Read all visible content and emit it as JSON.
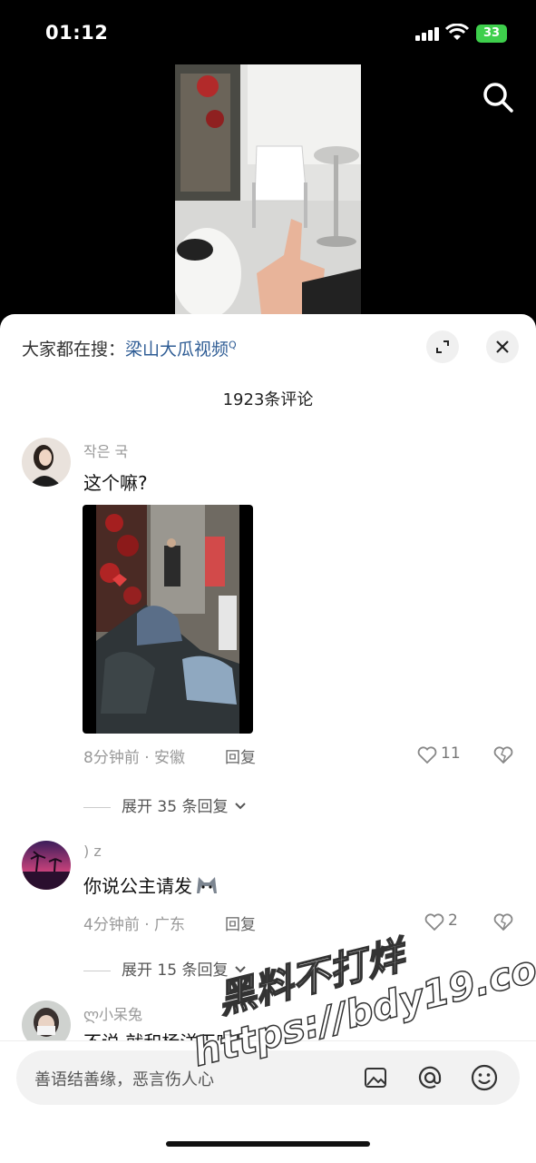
{
  "status_bar": {
    "time": "01:12",
    "battery": "33"
  },
  "hot_search": {
    "prefix": "大家都在搜：",
    "keyword": "梁山大瓜视频"
  },
  "comments_header": {
    "count_label": "1923条评论"
  },
  "comments": [
    {
      "user": "작은 국",
      "text": "这个嘛?",
      "time_location": "8分钟前 · 安徽",
      "reply_label": "回复",
      "likes": "11",
      "expand_label": "展开 35 条回复"
    },
    {
      "user": ") z",
      "text": "你说公主请发",
      "time_location": "4分钟前 · 广东",
      "reply_label": "回复",
      "likes": "2",
      "expand_label": "展开 15 条回复"
    },
    {
      "user": "ლ小呆兔",
      "text": "不说 就和杨洋干吗"
    }
  ],
  "input": {
    "placeholder": "善语结善缘，恶言伤人心"
  },
  "watermark": {
    "line1": "黑料不打烊",
    "line2": "https://bdy19.co"
  },
  "colors": {
    "accent": "#2f5d95",
    "battery": "#3ecf4c"
  }
}
